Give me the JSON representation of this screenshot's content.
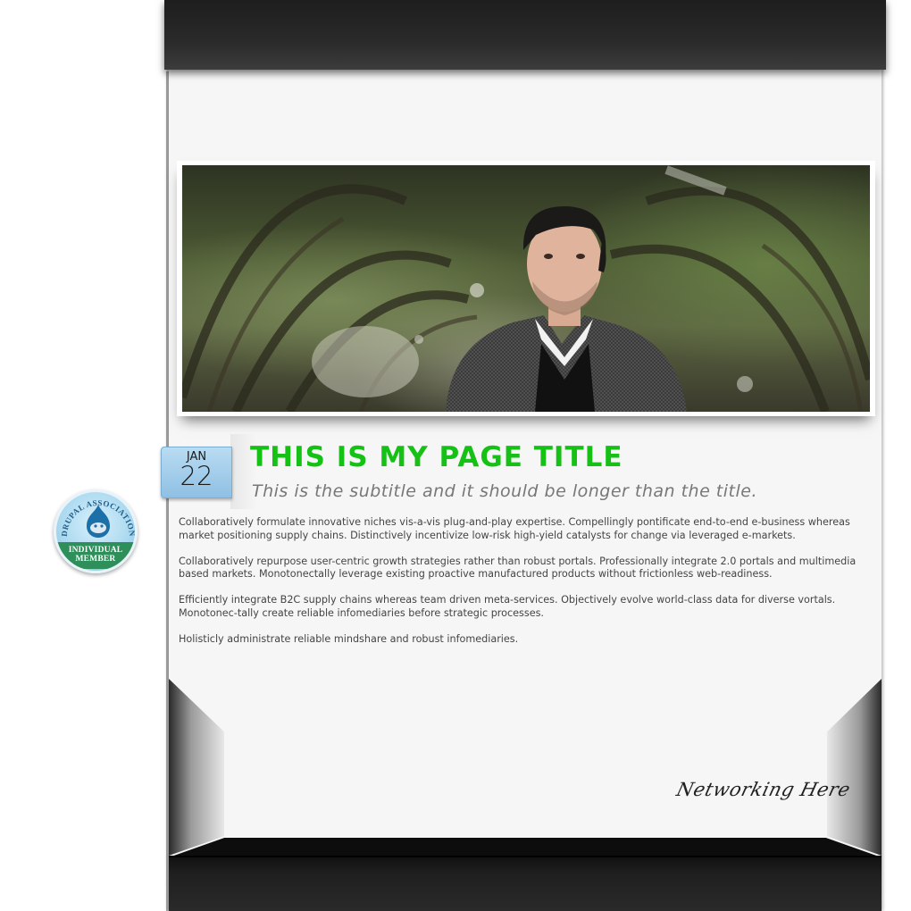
{
  "badge": {
    "ring_text": "DRUPAL ASSOCIATION",
    "band_line1": "INDIVIDUAL",
    "band_line2": "MEMBER",
    "icon": "drupal-drop-icon"
  },
  "post": {
    "date_month": "JAN",
    "date_day": "22",
    "title": "THIS IS MY PAGE TITLE",
    "subtitle": "This is the subtitle and it should be longer than the title.",
    "paragraphs": [
      "Collaboratively formulate innovative niches vis-a-vis plug-and-play expertise. Compellingly pontificate end-to-end e-business whereas market positioning supply chains. Distinctively incentivize low-risk high-yield catalysts for change via leveraged e-markets.",
      "Collaboratively repurpose user-centric growth strategies rather than robust portals. Professionally integrate 2.0 portals and multimedia based markets. Monotonectally leverage existing proactive manufactured products without frictionless web-readiness.",
      "Efficiently integrate B2C supply chains whereas team driven meta-services. Objectively evolve world-class data for diverse vortals. Monotonec-tally create reliable infomediaries before strategic processes.",
      "Holisticly administrate reliable mindshare and robust infomediaries."
    ]
  },
  "footer": {
    "networking_label": "Networking Here"
  },
  "colors": {
    "title_green": "#16c116",
    "date_tab_blue": "#a6cfec",
    "badge_green": "#2f8f5a"
  }
}
